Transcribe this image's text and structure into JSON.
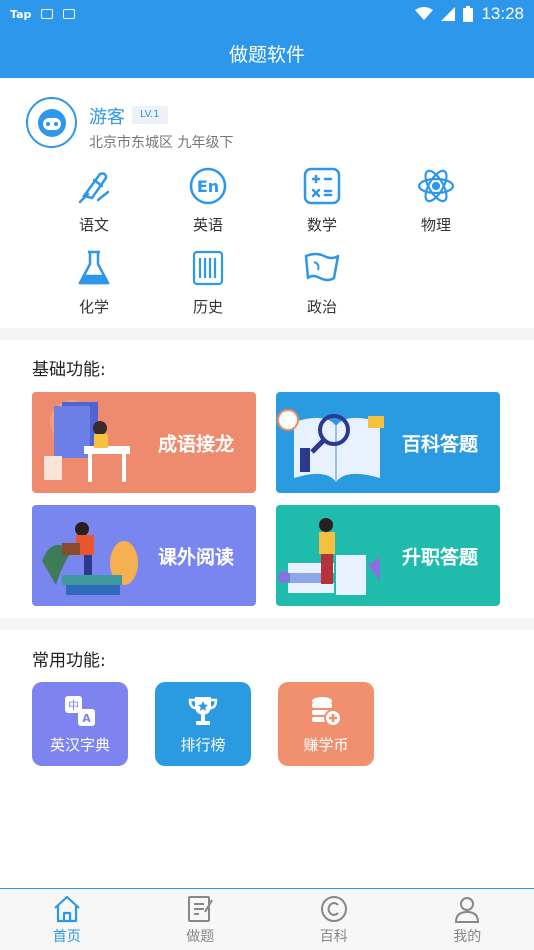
{
  "status_bar": {
    "app_indicator": "Tap",
    "time": "13:28"
  },
  "app_title": "做题软件",
  "profile": {
    "name": "游客",
    "level": "LV.1",
    "location": "北京市东城区 九年级下"
  },
  "subjects": [
    {
      "label": "语文",
      "icon": "pen-icon"
    },
    {
      "label": "英语",
      "icon": "english-icon"
    },
    {
      "label": "数学",
      "icon": "calculator-icon"
    },
    {
      "label": "物理",
      "icon": "atom-icon"
    },
    {
      "label": "化学",
      "icon": "flask-icon"
    },
    {
      "label": "历史",
      "icon": "scroll-icon"
    },
    {
      "label": "政治",
      "icon": "flag-icon"
    }
  ],
  "basic": {
    "title": "基础功能:",
    "cards": [
      {
        "label": "成语接龙",
        "color": "#ee8a6d"
      },
      {
        "label": "百科答题",
        "color": "#2a9be0"
      },
      {
        "label": "课外阅读",
        "color": "#7a86ef"
      },
      {
        "label": "升职答题",
        "color": "#1fbcae"
      }
    ]
  },
  "common": {
    "title": "常用功能:",
    "tools": [
      {
        "label": "英汉字典",
        "color": "#7d83ef",
        "icon": "translate-icon"
      },
      {
        "label": "排行榜",
        "color": "#2a9be0",
        "icon": "trophy-icon"
      },
      {
        "label": "赚学币",
        "color": "#f0906f",
        "icon": "coins-icon"
      }
    ]
  },
  "tabs": [
    {
      "label": "首页",
      "active": true
    },
    {
      "label": "做题",
      "active": false
    },
    {
      "label": "百科",
      "active": false
    },
    {
      "label": "我的",
      "active": false
    }
  ]
}
